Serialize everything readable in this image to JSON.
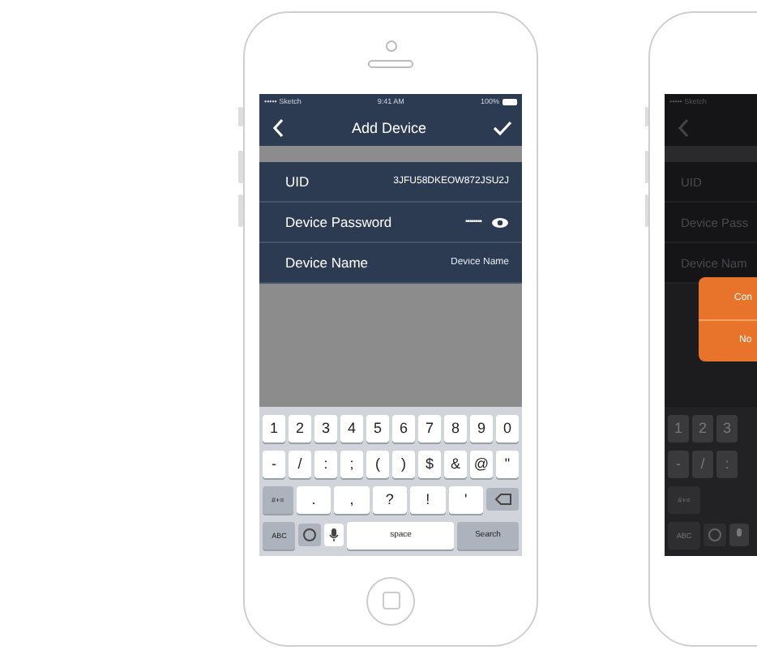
{
  "phone": {
    "status_bar": {
      "carrier": "••••• Sketch",
      "time": "9:41 AM",
      "battery": "100%"
    },
    "nav": {
      "title": "Add Device"
    },
    "fields": [
      {
        "kind": "text",
        "label": "UID",
        "value": "3JFU58DKEOW872JSU2J"
      },
      {
        "kind": "password",
        "label": "Device Password",
        "value": "••••••••"
      },
      {
        "kind": "text",
        "label": "Device Name",
        "placeholder": "Device Name"
      }
    ],
    "keyboard": [
      [
        {
          "kind": "key",
          "label": "1"
        },
        {
          "kind": "key",
          "label": "2"
        },
        {
          "kind": "key",
          "label": "3"
        },
        {
          "kind": "key",
          "label": "4"
        },
        {
          "kind": "key",
          "label": "5"
        },
        {
          "kind": "key",
          "label": "6"
        },
        {
          "kind": "key",
          "label": "7"
        },
        {
          "kind": "key",
          "label": "8"
        },
        {
          "kind": "key",
          "label": "9"
        },
        {
          "kind": "key",
          "label": "0"
        }
      ],
      [
        {
          "kind": "key",
          "label": "-"
        },
        {
          "kind": "key",
          "label": "/"
        },
        {
          "kind": "key",
          "label": ":"
        },
        {
          "kind": "key",
          "label": ";"
        },
        {
          "kind": "key",
          "label": "("
        },
        {
          "kind": "key",
          "label": ")"
        },
        {
          "kind": "key",
          "label": "$"
        },
        {
          "kind": "key",
          "label": "&"
        },
        {
          "kind": "key",
          "label": "@"
        },
        {
          "kind": "key",
          "label": "\""
        }
      ],
      [
        {
          "kind": "function",
          "label": "#+="
        },
        {
          "kind": "wide",
          "label": "."
        },
        {
          "kind": "wide",
          "label": ","
        },
        {
          "kind": "wide",
          "label": "?"
        },
        {
          "kind": "wide",
          "label": "!"
        },
        {
          "kind": "wide",
          "label": "'"
        },
        {
          "kind": "backspace"
        }
      ],
      [
        {
          "kind": "function",
          "label": "ABC"
        },
        {
          "kind": "emoji"
        },
        {
          "kind": "mic"
        },
        {
          "kind": "space",
          "label": "space"
        },
        {
          "kind": "return",
          "label": "Search"
        }
      ]
    ]
  },
  "second_phone": {
    "status_bar": {
      "carrier": "••••• Sketch"
    },
    "fields": [
      {
        "label": "UID"
      },
      {
        "label": "Device Pass"
      },
      {
        "label": "Device Nam"
      }
    ],
    "dialog": {
      "buttons": [
        "Con",
        "No"
      ]
    },
    "keyboard": [
      [
        {
          "kind": "key",
          "label": "1"
        },
        {
          "kind": "key",
          "label": "2"
        },
        {
          "kind": "key",
          "label": "3"
        }
      ],
      [
        {
          "kind": "key",
          "label": "-"
        },
        {
          "kind": "key",
          "label": "/"
        },
        {
          "kind": "key",
          "label": ":"
        }
      ],
      [
        {
          "kind": "function",
          "label": "#+="
        }
      ],
      [
        {
          "kind": "function",
          "label": "ABC"
        },
        {
          "kind": "emoji"
        },
        {
          "kind": "mic"
        }
      ]
    ]
  }
}
